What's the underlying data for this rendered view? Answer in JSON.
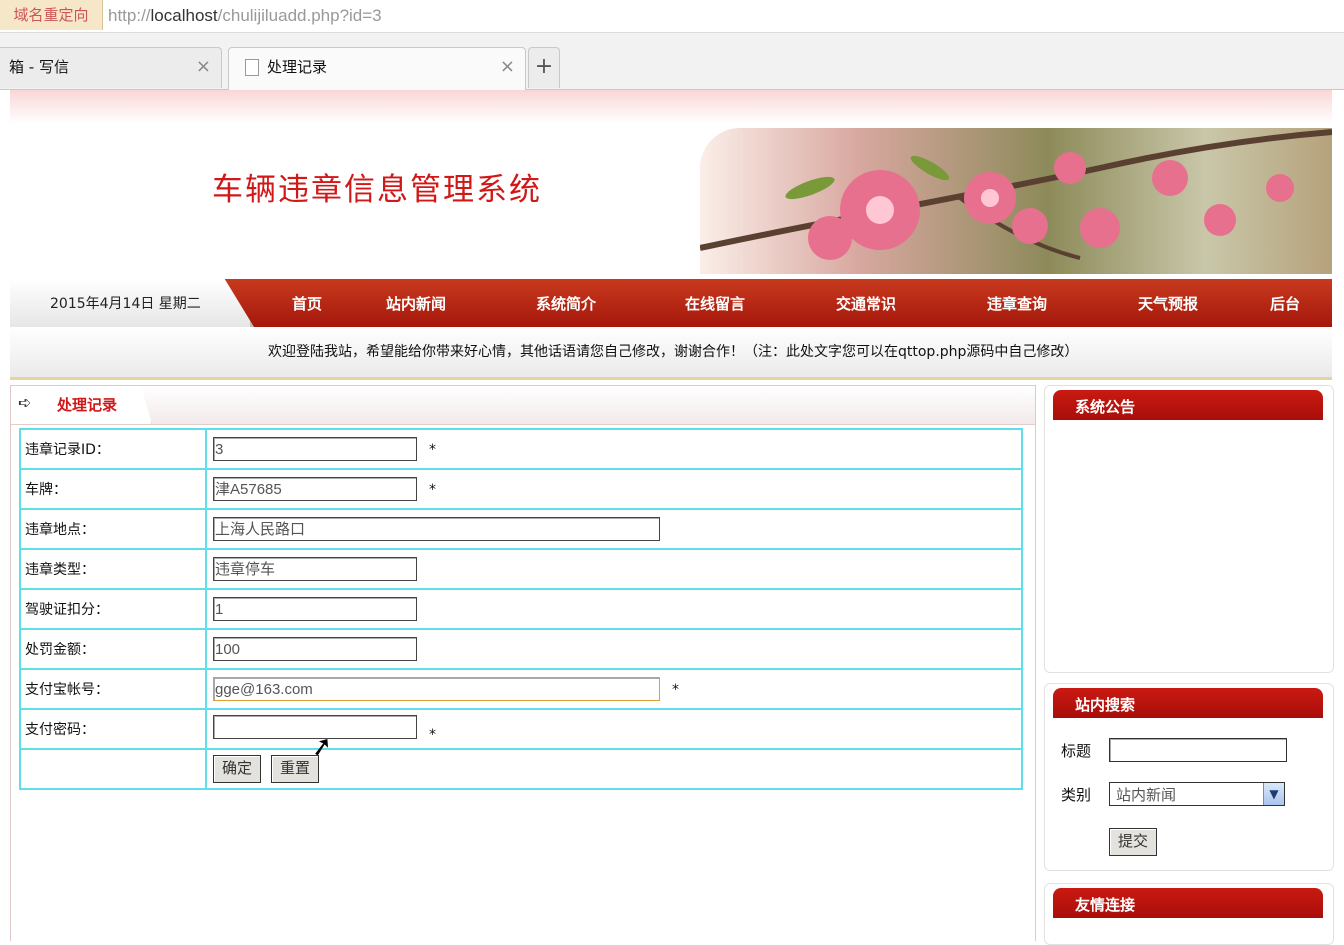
{
  "browser": {
    "redirect_badge": "域名重定向",
    "url_scheme": "http://",
    "url_host": "localhost",
    "url_path": "/chulijiluadd.php?id=3",
    "tabs": [
      {
        "label": "箱 - 写信",
        "close": "×"
      },
      {
        "label": "处理记录",
        "close": "×"
      }
    ],
    "new_tab": "+"
  },
  "site": {
    "title": "车辆违章信息管理系统",
    "date": "2015年4月14日 星期二",
    "nav": [
      "首页",
      "站内新闻",
      "系统简介",
      "在线留言",
      "交通常识",
      "违章查询",
      "天气预报",
      "后台"
    ],
    "welcome": "欢迎登陆我站，希望能给你带来好心情，其他话语请您自己修改，谢谢合作！（注：此处文字您可以在qttop.php源码中自己修改）"
  },
  "main": {
    "title": "处理记录",
    "fields": [
      {
        "label": "违章记录ID：",
        "value": "3",
        "required": "*"
      },
      {
        "label": "车牌：",
        "value": "津A57685",
        "required": "*"
      },
      {
        "label": "违章地点：",
        "value": "上海人民路口",
        "required": ""
      },
      {
        "label": "违章类型：",
        "value": "违章停车",
        "required": ""
      },
      {
        "label": "驾驶证扣分：",
        "value": "1",
        "required": ""
      },
      {
        "label": "处罚金额：",
        "value": "100",
        "required": ""
      },
      {
        "label": "支付宝帐号：",
        "value": "gge@163.com",
        "required": "*"
      },
      {
        "label": "支付密码：",
        "value": "",
        "required": "*"
      }
    ],
    "submit": "确定",
    "reset": "重置"
  },
  "sidebar": {
    "notice_title": "系统公告",
    "search_title": "站内搜索",
    "search_label_title": "标题",
    "search_label_category": "类别",
    "search_category_value": "站内新闻",
    "search_submit": "提交",
    "links_title": "友情连接"
  },
  "icons": {
    "arrow": "arrow-right-icon",
    "document": "document-icon",
    "dropdown": "chevron-down-icon",
    "cursor": "mouse-cursor-icon"
  },
  "colors": {
    "accent_red": "#d01818",
    "nav_red": "#b8220f",
    "table_border": "#5fe0e8"
  }
}
